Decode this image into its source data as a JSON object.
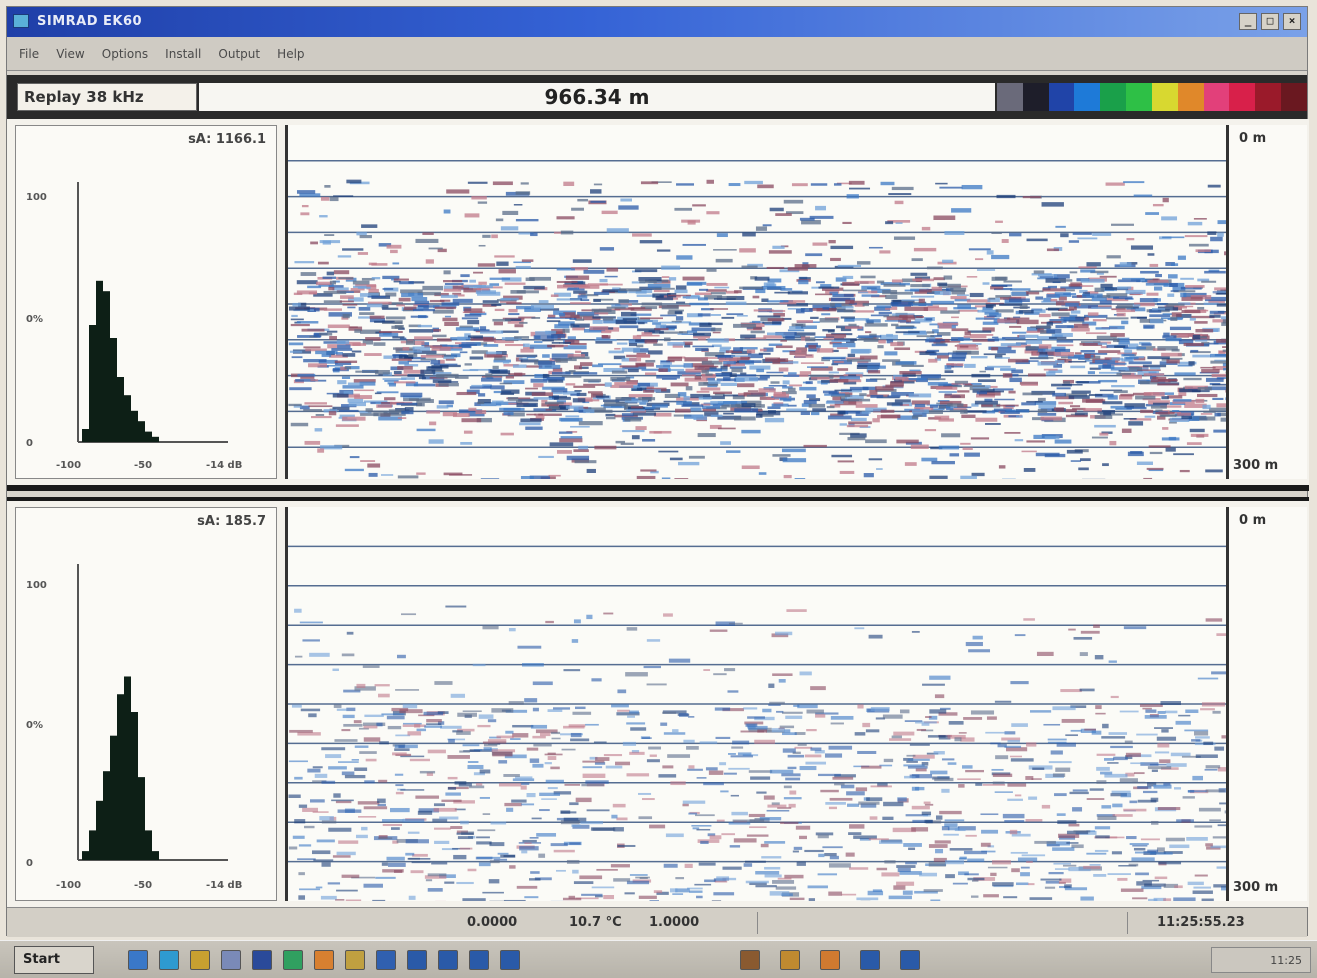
{
  "window": {
    "title": "SIMRAD EK60",
    "icons": [
      "app-icon",
      "minimize-icon",
      "maximize-icon",
      "close-icon"
    ]
  },
  "menu": [
    "File",
    "View",
    "Options",
    "Install",
    "Output",
    "Help"
  ],
  "infobar": {
    "mode": "Replay  38 kHz",
    "depth": "966.34 m",
    "color_scale": [
      "#6a6a7a",
      "#1e1e2a",
      "#2044a8",
      "#1e7ad8",
      "#1aa04a",
      "#2ec046",
      "#d8d830",
      "#e0882a",
      "#e2407a",
      "#d8204a",
      "#9a1a2a",
      "#6a1820"
    ]
  },
  "panels": [
    {
      "sa_label": "sA:  1166.1",
      "y_ticks": [
        "100",
        "0%",
        "0"
      ],
      "x_ticks": [
        "-100",
        "-50",
        "-14  dB"
      ],
      "depth_top": "0 m",
      "depth_bottom": "300 m",
      "histogram": [
        0.05,
        0.45,
        0.62,
        0.58,
        0.4,
        0.25,
        0.18,
        0.12,
        0.08,
        0.04,
        0.02
      ],
      "density": "high"
    },
    {
      "sa_label": "sA:  185.7",
      "y_ticks": [
        "100",
        "0%",
        "0"
      ],
      "x_ticks": [
        "-100",
        "-50",
        "-14  dB"
      ],
      "depth_top": "0 m",
      "depth_bottom": "300 m",
      "histogram": [
        0.03,
        0.1,
        0.2,
        0.3,
        0.42,
        0.56,
        0.62,
        0.5,
        0.28,
        0.1,
        0.03
      ],
      "density": "low"
    }
  ],
  "status": {
    "field1": "0.0000",
    "temperature": "10.7 °C",
    "field3": "1.0000",
    "time": "11:25:55.23"
  },
  "taskbar": {
    "start_label": "Start",
    "clock": "11:25",
    "icons": [
      "ie-icon",
      "explorer-icon",
      "outlook-icon",
      "folder-icon",
      "window-icon",
      "network-icon",
      "app-icon",
      "app-icon",
      "app-icon",
      "app-icon",
      "app-icon",
      "app-icon",
      "app-icon",
      "app-icon",
      "app-icon",
      "app-icon",
      "app-icon",
      "app-icon"
    ]
  }
}
